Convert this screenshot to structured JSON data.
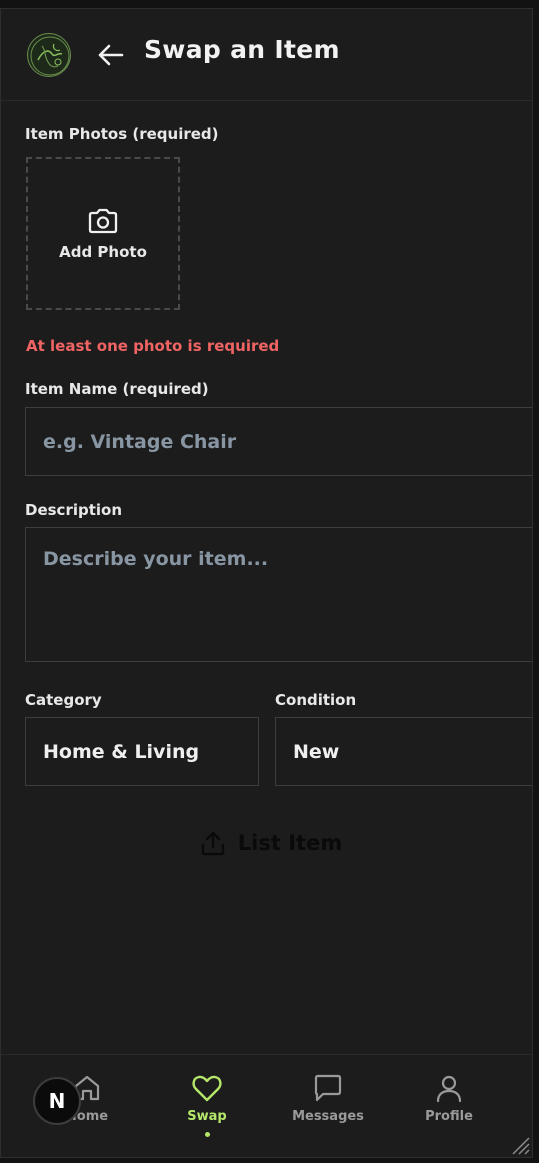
{
  "header": {
    "title": "Swap an Item",
    "logo_icon": "leaf-globe-logo",
    "back_icon": "arrow-left-icon"
  },
  "photos": {
    "label": "Item Photos (required)",
    "add_label": "Add Photo",
    "icon": "camera-icon",
    "error": "At least one photo is required"
  },
  "name": {
    "label": "Item Name (required)",
    "placeholder": "e.g. Vintage Chair",
    "value": ""
  },
  "description": {
    "label": "Description",
    "placeholder": "Describe your item...",
    "value": ""
  },
  "category": {
    "label": "Category",
    "value": "Home & Living"
  },
  "condition": {
    "label": "Condition",
    "value": "New"
  },
  "submit": {
    "label": "List Item",
    "icon": "upload-icon"
  },
  "nav": {
    "items": [
      {
        "label": "Home",
        "icon": "home-icon"
      },
      {
        "label": "Swap",
        "icon": "heart-icon"
      },
      {
        "label": "Messages",
        "icon": "message-icon"
      },
      {
        "label": "Profile",
        "icon": "user-icon"
      }
    ],
    "active_index": 1
  },
  "dev_badge": {
    "label": "N"
  },
  "colors": {
    "accent": "#b5e86a",
    "error": "#f06464",
    "background": "#1c1c1c"
  }
}
